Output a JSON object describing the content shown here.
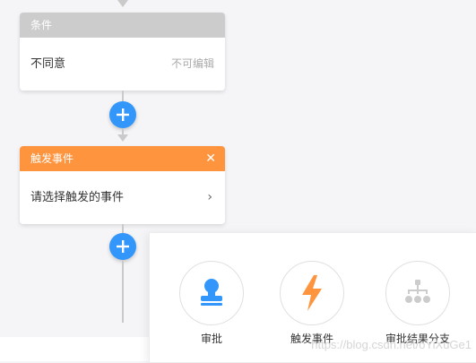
{
  "condition_node": {
    "header": "条件",
    "body_text": "不同意",
    "hint": "不可编辑",
    "header_color": "#cccccc"
  },
  "trigger_node": {
    "header": "触发事件",
    "close_glyph": "✕",
    "body_text": "请选择触发的事件",
    "chevron_glyph": "›",
    "header_color": "#ff943e"
  },
  "add_button": {
    "glyph": "+",
    "color": "#3296fa"
  },
  "popover": {
    "options": [
      {
        "label": "审批",
        "icon": "stamp-icon",
        "color": "#3296fa"
      },
      {
        "label": "触发事件",
        "icon": "lightning-icon",
        "color": "#ff943e"
      },
      {
        "label": "审批结果分支",
        "icon": "branch-icon",
        "color": "#cccccc"
      }
    ]
  },
  "watermark": "https://blog.csdn.net/oYiXuGe1"
}
